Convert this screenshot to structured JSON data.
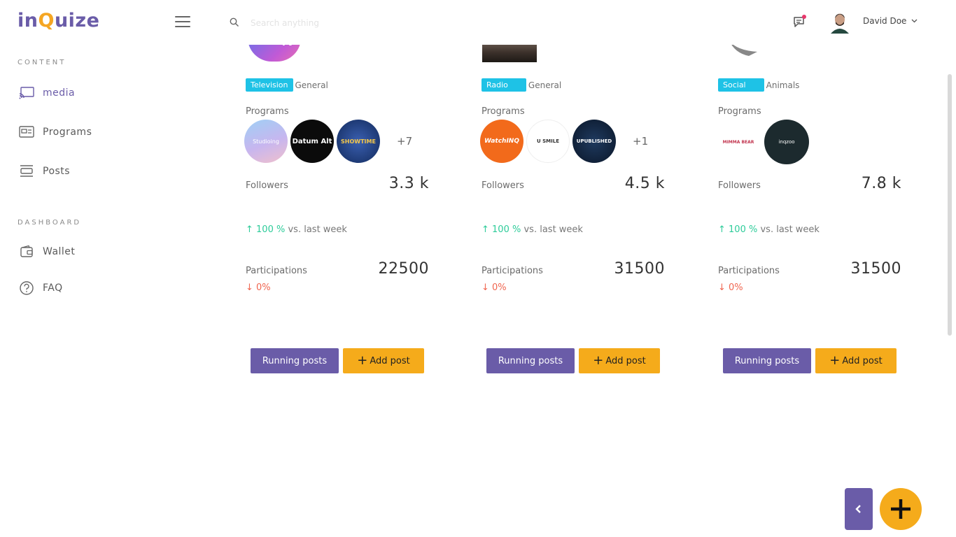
{
  "header": {
    "logo_text": "inQuize",
    "search_placeholder": "Search anything",
    "user_name": "David Doe"
  },
  "sidebar": {
    "sections": [
      {
        "label": "CONTENT",
        "items": [
          {
            "label": "media",
            "icon": "cast-icon"
          },
          {
            "label": "Programs",
            "icon": "programs-icon"
          },
          {
            "label": "Posts",
            "icon": "posts-icon"
          }
        ]
      },
      {
        "label": "DASHBOARD",
        "items": [
          {
            "label": "Wallet",
            "icon": "wallet-icon"
          },
          {
            "label": "FAQ",
            "icon": "help-circle-icon"
          }
        ]
      }
    ]
  },
  "cards": [
    {
      "image_text": "TV",
      "tag": "Television",
      "category": "General",
      "programs_label": "Programs",
      "programs": [
        {
          "name": "Studioing",
          "color": "#b9b4f0"
        },
        {
          "name": "Datum Alt",
          "color": "#0b0b0b"
        },
        {
          "name": "SHOWTIME",
          "color": "#1d3a7a"
        }
      ],
      "programs_more": "+7",
      "followers_label": "Followers",
      "followers_value": "3.3 k",
      "trend_value": "100 %",
      "trend_text": "vs. last week",
      "participations_label": "Participations",
      "participations_value": "22500",
      "participations_change": "0%",
      "running_label": "Running posts",
      "add_label": "Add post"
    },
    {
      "image_text": "",
      "tag": "Radio",
      "category": "General",
      "programs_label": "Programs",
      "programs": [
        {
          "name": "WatchINQ",
          "color": "#f26a1b"
        },
        {
          "name": "U SMILE",
          "color": "#ffffff"
        },
        {
          "name": "UPUBLISHED",
          "color": "#0e2240"
        }
      ],
      "programs_more": "+1",
      "followers_label": "Followers",
      "followers_value": "4.5 k",
      "trend_value": "100 %",
      "trend_text": "vs. last week",
      "participations_label": "Participations",
      "participations_value": "31500",
      "participations_change": "0%",
      "running_label": "Running posts",
      "add_label": "Add post"
    },
    {
      "image_text": "",
      "tag": "Social",
      "category": "Animals",
      "programs_label": "Programs",
      "programs": [
        {
          "name": "MIMMA BEAR",
          "color": "#ffffff"
        },
        {
          "name": "inqzoo",
          "color": "#1c2a2e"
        }
      ],
      "programs_more": "",
      "followers_label": "Followers",
      "followers_value": "7.8 k",
      "trend_value": "100 %",
      "trend_text": "vs. last week",
      "participations_label": "Participations",
      "participations_value": "31500",
      "participations_change": "0%",
      "running_label": "Running posts",
      "add_label": "Add post"
    }
  ],
  "colors": {
    "primary": "#6a5ca8",
    "accent": "#f5ab1b",
    "tag": "#1ec2e6",
    "up": "#2ecc9a",
    "down": "#f06650"
  }
}
